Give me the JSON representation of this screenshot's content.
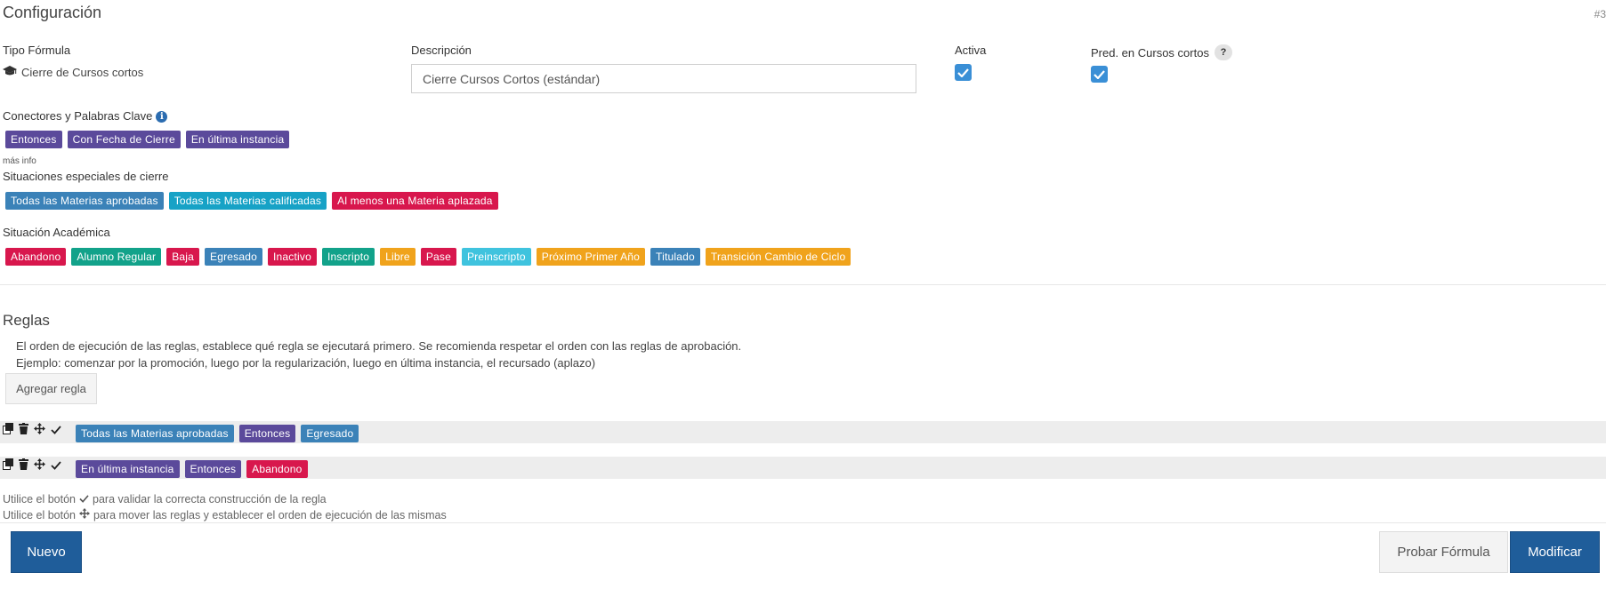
{
  "page": {
    "title": "Configuración",
    "id_label": "#3"
  },
  "fields": {
    "tipo_label": "Tipo Fórmula",
    "tipo_value": "Cierre de Cursos cortos",
    "desc_label": "Descripción",
    "desc_value": "Cierre Cursos Cortos (estándar)",
    "activa_label": "Activa",
    "activa_checked": true,
    "pred_label": "Pred. en Cursos cortos",
    "pred_help": "?",
    "pred_checked": true
  },
  "conectores": {
    "title": "Conectores y Palabras Clave",
    "info_icon": "i",
    "items": [
      {
        "label": "Entonces",
        "color": "#5b4a9b"
      },
      {
        "label": "Con Fecha de Cierre",
        "color": "#5b4a9b"
      },
      {
        "label": "En última instancia",
        "color": "#5b4a9b"
      }
    ],
    "more_info": "más info"
  },
  "situaciones": {
    "title": "Situaciones especiales de cierre",
    "items": [
      {
        "label": "Todas las Materias aprobadas",
        "color": "#3b82b8"
      },
      {
        "label": "Todas las Materias calificadas",
        "color": "#17a2c6"
      },
      {
        "label": "Al menos una Materia aplazada",
        "color": "#d8174d"
      }
    ]
  },
  "situacion_academica": {
    "title": "Situación Académica",
    "items": [
      {
        "label": "Abandono",
        "color": "#d8174d"
      },
      {
        "label": "Alumno Regular",
        "color": "#12a28a"
      },
      {
        "label": "Baja",
        "color": "#d8174d"
      },
      {
        "label": "Egresado",
        "color": "#3b82b8"
      },
      {
        "label": "Inactivo",
        "color": "#d8174d"
      },
      {
        "label": "Inscripto",
        "color": "#12a28a"
      },
      {
        "label": "Libre",
        "color": "#f0a31c"
      },
      {
        "label": "Pase",
        "color": "#d8174d"
      },
      {
        "label": "Preinscripto",
        "color": "#3fc3de"
      },
      {
        "label": "Próximo Primer Año",
        "color": "#f0a31c"
      },
      {
        "label": "Titulado",
        "color": "#3b82b8"
      },
      {
        "label": "Transición Cambio de Ciclo",
        "color": "#f0a31c"
      }
    ]
  },
  "reglas": {
    "title": "Reglas",
    "desc_line1": "El orden de ejecución de las reglas, establece qué regla se ejecutará primero. Se recomienda respetar el orden con las reglas de aprobación.",
    "desc_line2": "Ejemplo: comenzar por la promoción, luego por la regularización, luego en última instancia, el recursado (aplazo)",
    "add_button": "Agregar regla",
    "rows": [
      {
        "tags": [
          {
            "label": "Todas las Materias aprobadas",
            "color": "#3b82b8"
          },
          {
            "label": "Entonces",
            "color": "#5b4a9b"
          },
          {
            "label": "Egresado",
            "color": "#3b82b8"
          }
        ]
      },
      {
        "tags": [
          {
            "label": "En última instancia",
            "color": "#5b4a9b"
          },
          {
            "label": "Entonces",
            "color": "#5b4a9b"
          },
          {
            "label": "Abandono",
            "color": "#d8174d"
          }
        ]
      }
    ],
    "hint1_pre": "Utilice el botón",
    "hint1_post": "para validar la correcta construcción de la regla",
    "hint2_pre": "Utilice el botón",
    "hint2_post": "para mover las reglas y establecer el orden de ejecución de las mismas"
  },
  "footer": {
    "nuevo": "Nuevo",
    "probar": "Probar Fórmula",
    "modificar": "Modificar"
  }
}
